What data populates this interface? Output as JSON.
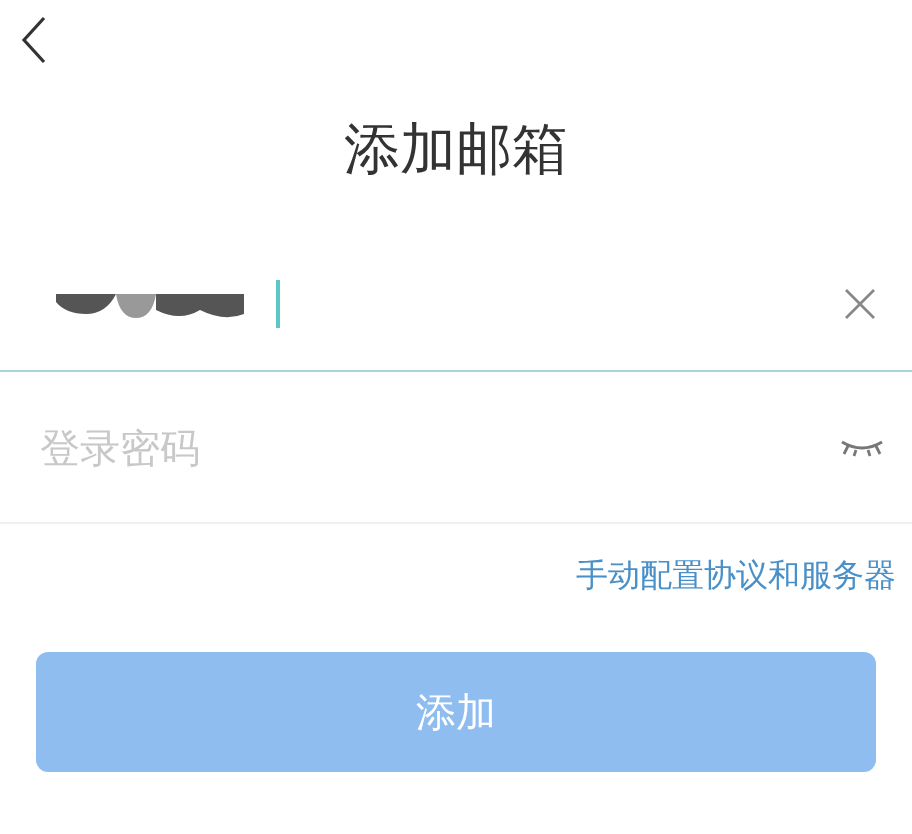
{
  "header": {
    "title": "添加邮箱"
  },
  "email_field": {
    "focused": true
  },
  "password_field": {
    "placeholder": "登录密码",
    "visible": false
  },
  "manual_config_link": "手动配置协议和服务器",
  "submit_button": {
    "label": "添加",
    "disabled": true
  }
}
